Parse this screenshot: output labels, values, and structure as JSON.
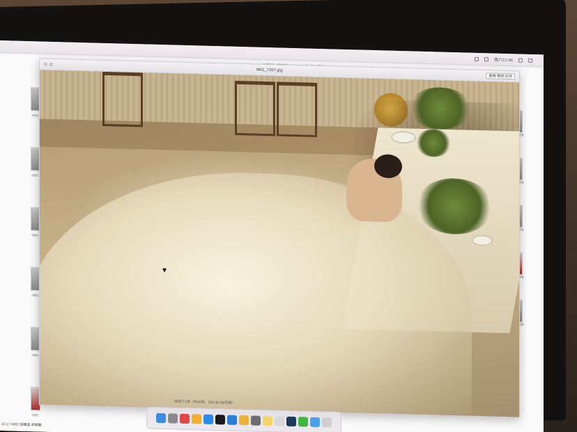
{
  "menubar": {
    "clock": "周六21:06"
  },
  "finder": {
    "window_title": "10.17 4002 张曦遥 胡晓敏（LEON 宁宁）副本",
    "left_thumbs": [
      {
        "caption": "IMG",
        "red": false
      },
      {
        "caption": "IMG",
        "red": false
      },
      {
        "caption": "IMG",
        "red": false
      },
      {
        "caption": "IMG",
        "red": false
      },
      {
        "caption": "IMG",
        "red": false
      },
      {
        "caption": "IMG",
        "red": true
      }
    ],
    "right_thumbs": [
      {
        "caption": "IMG.jpg",
        "red": false
      },
      {
        "caption": "IMG.jpg",
        "red": false
      },
      {
        "caption": "IMG.jpg",
        "red": false
      },
      {
        "caption": "IMG.jpg",
        "red": true
      },
      {
        "caption": "IMG.jpg",
        "red": false
      }
    ],
    "footer": "10.17 4002 张曦遥 胡晓敏"
  },
  "preview": {
    "filename": "IMG_7267.jpg",
    "open_button": "使用\"预览\"打开"
  },
  "dock": {
    "status_text": "选择了1项（共45项，308.38 GB可用）",
    "icons": [
      {
        "name": "finder",
        "color": "#3c8de0"
      },
      {
        "name": "launchpad",
        "color": "#8a8a8a"
      },
      {
        "name": "calendar",
        "color": "#e04848"
      },
      {
        "name": "photos",
        "color": "#f0b030"
      },
      {
        "name": "safari",
        "color": "#2a8ce6"
      },
      {
        "name": "qq",
        "color": "#1a1a1a"
      },
      {
        "name": "app-store",
        "color": "#2a7fd8"
      },
      {
        "name": "chrome",
        "color": "#e9b23c"
      },
      {
        "name": "settings",
        "color": "#6d6d6d"
      },
      {
        "name": "notes",
        "color": "#f4d56a"
      },
      {
        "name": "preview",
        "color": "#d9d9d9"
      },
      {
        "name": "photoshop",
        "color": "#1e3a5a"
      },
      {
        "name": "wechat",
        "color": "#3fb63f"
      },
      {
        "name": "downloads",
        "color": "#4aa1e8"
      },
      {
        "name": "trash",
        "color": "#cfcfcf"
      }
    ]
  }
}
